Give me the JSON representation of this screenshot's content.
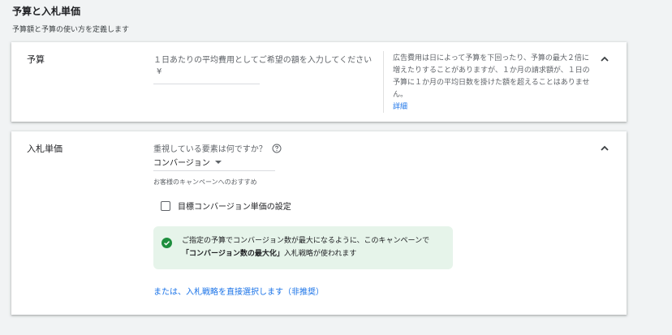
{
  "section": {
    "title": "予算と入札単価",
    "subtitle": "予算額と予算の使い方を定義します"
  },
  "budget": {
    "label": "予算",
    "input_hint": "１日あたりの平均費用としてご希望の額を入力してください",
    "currency_symbol": "¥",
    "help_text": "広告費用は日によって予算を下回ったり、予算の最大２倍に増えたりすることがありますが、１か月の請求額が、１日の予算に１か月の平均日数を掛けた額を超えることはありません。",
    "help_link": "詳細",
    "chevron_icon": "chevron-up-icon"
  },
  "bidding": {
    "label": "入札単価",
    "question": "重視している要素は何ですか？",
    "question_icon": "help-circle-icon",
    "dropdown_value": "コンバージョン",
    "recommendation": "お客様のキャンペーンへのおすすめ",
    "checkbox_label": "目標コンバージョン単価の設定",
    "checkbox_checked": false,
    "info_line1": "ご指定の予算でコンバージョン数が最大になるように、このキャンペーンで",
    "info_line2_bold": "「コンバージョン数の最大化」",
    "info_line2_rest": "入札戦略が使われます",
    "info_icon": "check-circle-icon",
    "manual_link": "または、入札戦略を直接選択します（非推奨）",
    "chevron_icon": "chevron-up-icon"
  },
  "colors": {
    "link": "#1a73e8",
    "success_bg": "#e6f4ea",
    "success_icon": "#1e8e3e"
  }
}
